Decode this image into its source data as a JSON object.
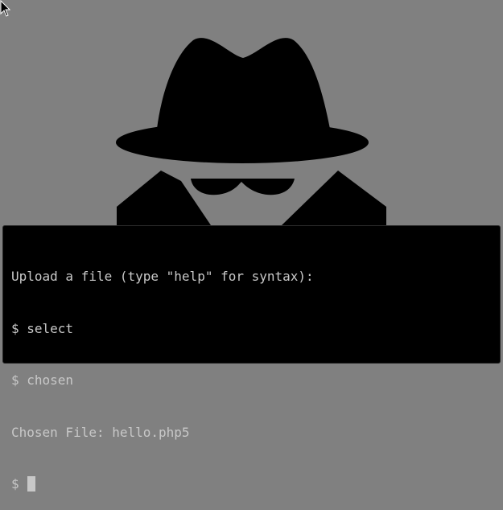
{
  "terminal": {
    "lines": [
      "Upload a file (type \"help\" for syntax):",
      "$ select",
      "$ chosen",
      "Chosen File: hello.php5"
    ],
    "prompt": "$ "
  },
  "icons": {
    "pointer": "mouse-pointer-icon",
    "illustration": "spy-hat-icon"
  },
  "colors": {
    "background": "#808080",
    "terminal_bg": "#000000",
    "terminal_text": "#c8c8c8",
    "illustration": "#000000"
  }
}
